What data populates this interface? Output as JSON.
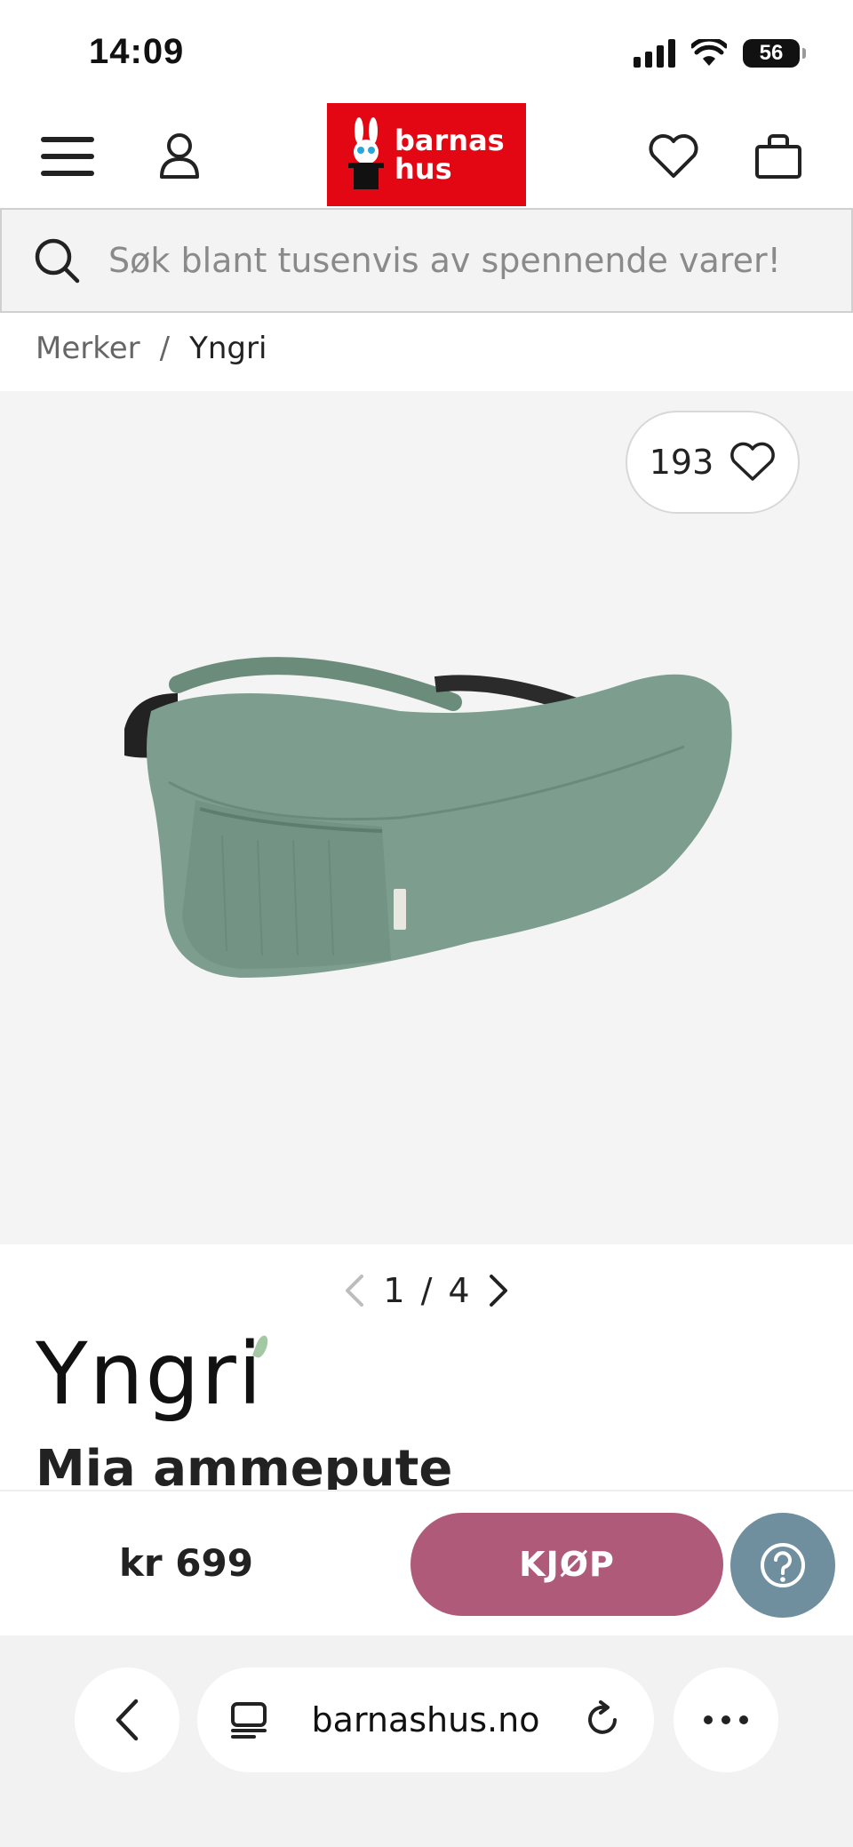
{
  "status": {
    "time": "14:09",
    "battery": "56"
  },
  "header": {
    "logo_line1": "barnas",
    "logo_line2": "hus"
  },
  "search": {
    "placeholder": "Søk blant tusenvis av spennende varer!"
  },
  "breadcrumb": {
    "items": [
      "Merker",
      "Yngri"
    ],
    "separator": "/"
  },
  "gallery": {
    "likes": "193",
    "pager_current": "1",
    "pager_sep": "/",
    "pager_total": "4"
  },
  "product": {
    "brand_logo": "Yngri",
    "title": "Mia ammepute",
    "color": "#7d9e8e"
  },
  "buy": {
    "price": "kr 699",
    "buy_label": "KJØP",
    "accent": "#b05a7a",
    "help_color": "#6f8e9e"
  },
  "browser": {
    "url": "barnashus.no"
  }
}
